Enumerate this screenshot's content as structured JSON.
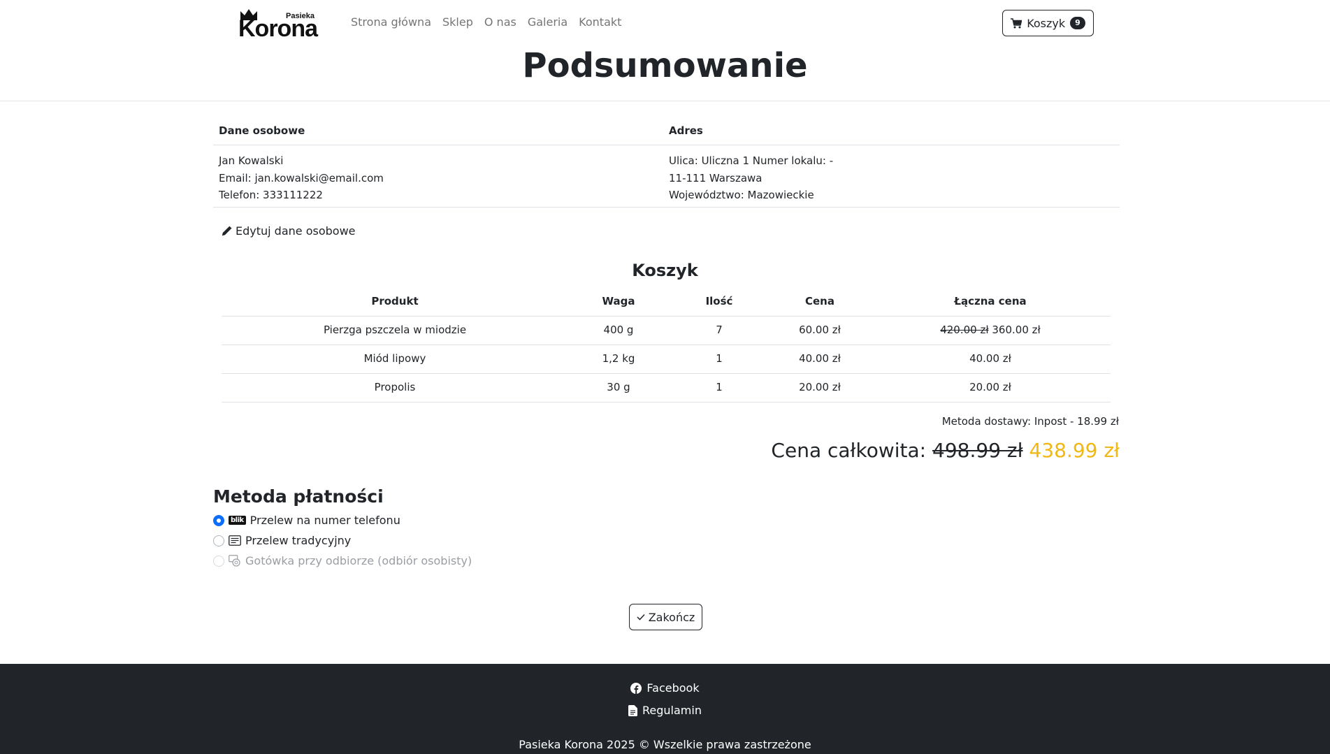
{
  "header": {
    "logo_small": "Pasieka",
    "logo_big": "Korona",
    "nav": [
      "Strona główna",
      "Sklep",
      "O nas",
      "Galeria",
      "Kontakt"
    ],
    "cart_label": "Koszyk",
    "cart_count": "9",
    "page_title": "Podsumowanie"
  },
  "customer": {
    "personal_heading": "Dane osobowe",
    "address_heading": "Adres",
    "name": "Jan Kowalski",
    "email": "Email: jan.kowalski@email.com",
    "phone": "Telefon: 333111222",
    "street": "Ulica: Uliczna 1 Numer lokalu: -",
    "city": "11-111 Warszawa",
    "region": "Województwo: Mazowieckie",
    "edit_label": "Edytuj dane osobowe"
  },
  "cart": {
    "heading": "Koszyk",
    "columns": [
      "Produkt",
      "Waga",
      "Ilość",
      "Cena",
      "Łączna cena"
    ],
    "rows": [
      {
        "product": "Pierzga pszczela w miodzie",
        "weight": "400 g",
        "qty": "7",
        "price": "60.00 zł",
        "total_old": "420.00 zł",
        "total": "360.00 zł"
      },
      {
        "product": "Miód lipowy",
        "weight": "1,2 kg",
        "qty": "1",
        "price": "40.00 zł",
        "total_old": "",
        "total": "40.00 zł"
      },
      {
        "product": "Propolis",
        "weight": "30 g",
        "qty": "1",
        "price": "20.00 zł",
        "total_old": "",
        "total": "20.00 zł"
      }
    ],
    "delivery": "Metoda dostawy: Inpost - 18.99 zł",
    "total_label": "Cena całkowita:",
    "total_old": "498.99 zł",
    "total_new": "438.99 zł",
    "total_new_color": "#f1b814"
  },
  "payment": {
    "heading": "Metoda płatności",
    "options": [
      {
        "label": "Przelew na numer telefonu",
        "icon": "blik-icon",
        "icon_text": "blik",
        "checked": true,
        "disabled": false
      },
      {
        "label": "Przelew tradycyjny",
        "icon": "transfer-icon",
        "checked": false,
        "disabled": false
      },
      {
        "label": "Gotówka przy odbiorze (odbiór osobisty)",
        "icon": "cash-icon",
        "checked": false,
        "disabled": true
      }
    ],
    "finish_label": "Zakończ"
  },
  "footer": {
    "facebook": "Facebook",
    "terms": "Regulamin",
    "copyright": "Pasieka Korona 2025 © Wszelkie prawa zastrzeżone"
  }
}
